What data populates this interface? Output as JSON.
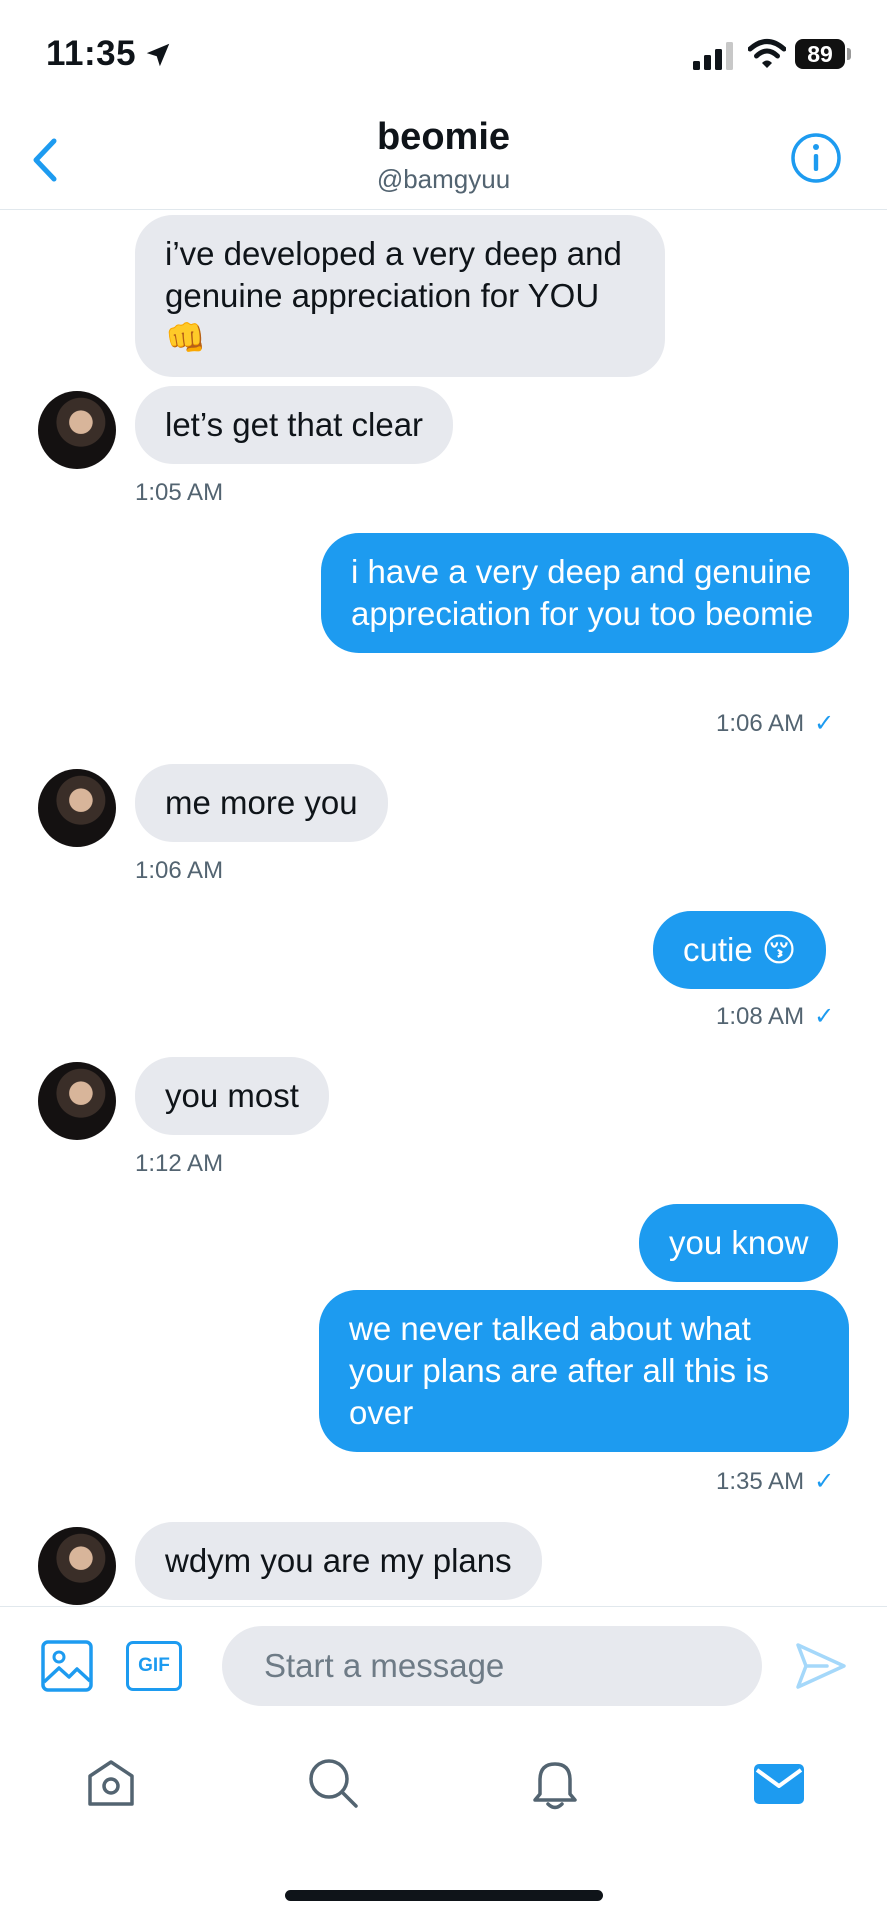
{
  "status": {
    "time": "11:35",
    "battery": "89"
  },
  "header": {
    "name": "beomie",
    "handle": "@bamgyuu"
  },
  "messages": [
    {
      "text": "i’ve developed a very deep and genuine appreciation for YOU👊"
    },
    {
      "text": "let’s get that clear"
    },
    {
      "text": "1:05 AM"
    },
    {
      "text": "i have a very deep and genuine appreciation for you too beomie"
    },
    {
      "text": "1:06 AM"
    },
    {
      "text": "me more you"
    },
    {
      "text": "1:06 AM"
    },
    {
      "text": "cutie 😚"
    },
    {
      "text": "1:08 AM"
    },
    {
      "text": "you most"
    },
    {
      "text": "1:12 AM"
    },
    {
      "text": "you know"
    },
    {
      "text": "we never talked about what your plans are after all this is over"
    },
    {
      "text": "1:35 AM"
    },
    {
      "text": "wdym you are my plans"
    }
  ],
  "composer": {
    "gif_label": "GIF",
    "placeholder": "Start a message"
  },
  "colors": {
    "accent": "#1d9bf0",
    "incoming_bubble": "#e7e9ee",
    "text": "#0f1419",
    "muted": "#536471"
  },
  "icons": [
    "location-arrow-icon",
    "signal-icon",
    "wifi-icon",
    "back-chevron-icon",
    "info-icon",
    "image-icon",
    "send-icon",
    "home-icon",
    "search-icon",
    "bell-icon",
    "mail-icon"
  ]
}
